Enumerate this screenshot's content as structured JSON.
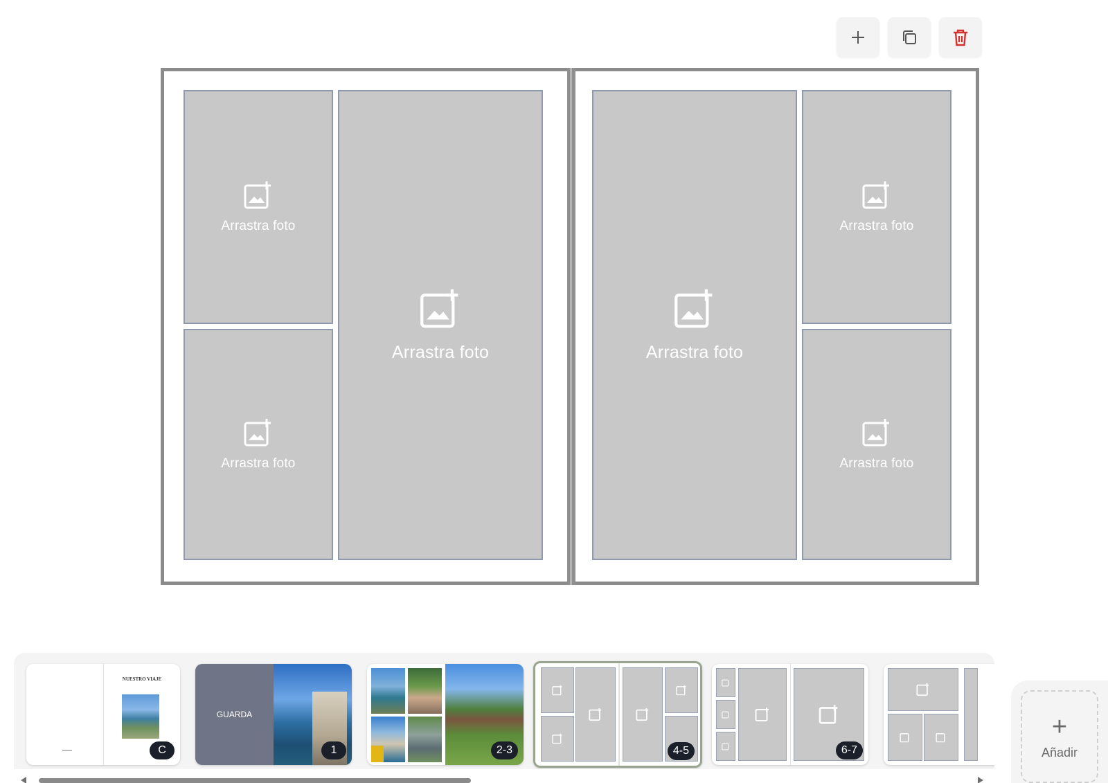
{
  "toolbar": {
    "add_icon": "plus-icon",
    "duplicate_icon": "copy-icon",
    "delete_icon": "trash-icon",
    "delete_color": "#d3312f"
  },
  "spread": {
    "slot_label": "Arrastra foto",
    "slot_color": "#c8c8c8",
    "border_color": "#8f98ad"
  },
  "strip": {
    "thumbs": [
      {
        "badge": "C",
        "cover_text": "NUESTRO VIAJE"
      },
      {
        "badge": "1",
        "endpaper_text": "GUARDA"
      },
      {
        "badge": "2-3"
      },
      {
        "badge": "4-5",
        "active": true
      },
      {
        "badge": "6-7"
      },
      {
        "badge": ""
      }
    ]
  },
  "add": {
    "label": "Añadir"
  }
}
